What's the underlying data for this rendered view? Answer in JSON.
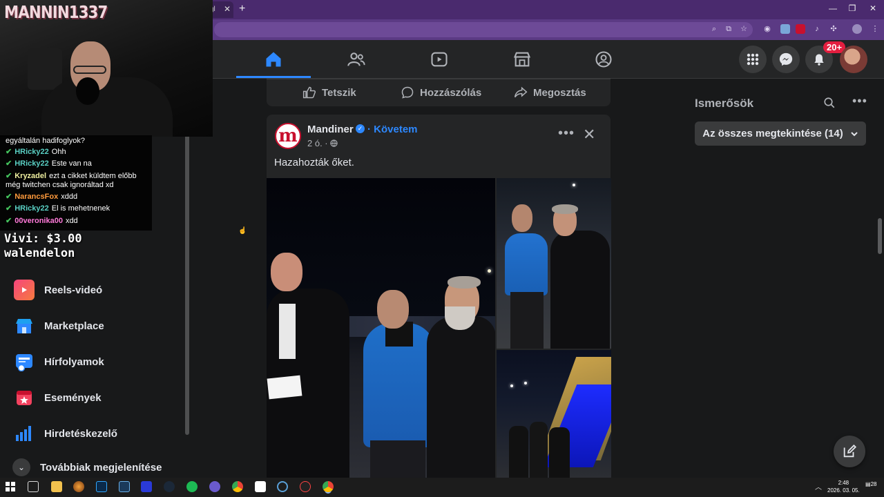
{
  "browser": {
    "tab_title": "gl",
    "tab_close": "✕",
    "new_tab": "+",
    "window_buttons": [
      "—",
      "❐",
      "✕"
    ]
  },
  "overlay": {
    "streamer_name": "MANNIN1337",
    "chat": [
      {
        "user": "",
        "user_color": "#ffffff",
        "badge": "",
        "message": "egyáltalán hadifoglyok?"
      },
      {
        "user": "HRicky22",
        "user_color": "#5ad0c4",
        "badge": "✔",
        "message": "Ohh"
      },
      {
        "user": "HRicky22",
        "user_color": "#5ad0c4",
        "badge": "✔",
        "message": "Este van na"
      },
      {
        "user": "Kryzadel",
        "user_color": "#f0f0a0",
        "badge": "✔",
        "message": "ezt a cikket küldtem előbb"
      },
      {
        "user": "",
        "user_color": "#ffffff",
        "badge": "",
        "message": "még twitchen csak ignoráltad xd"
      },
      {
        "user": "NarancsFox",
        "user_color": "#ff9a3c",
        "badge": "✔",
        "message": "xddd"
      },
      {
        "user": "HRicky22",
        "user_color": "#5ad0c4",
        "badge": "✔",
        "message": "El is mehetnenek"
      },
      {
        "user": "00veronika00",
        "user_color": "#ff7ad9",
        "badge": "✔",
        "message": "xdd"
      }
    ],
    "donation_line1": "Vivi: $3.00",
    "donation_line2": "walendelon"
  },
  "sidebar": {
    "items": [
      {
        "label": "Reels-videó",
        "icon": "reels-icon"
      },
      {
        "label": "Marketplace",
        "icon": "marketplace-icon"
      },
      {
        "label": "Hírfolyamok",
        "icon": "feeds-icon"
      },
      {
        "label": "Események",
        "icon": "events-icon"
      },
      {
        "label": "Hirdetéskezelő",
        "icon": "ads-manager-icon"
      }
    ],
    "more_label": "Továbbiak megjelenítése"
  },
  "feed": {
    "actions": {
      "like": "Tetszik",
      "comment": "Hozzászólás",
      "share": "Megosztás"
    },
    "post": {
      "page_logo_letter": "m",
      "page_name": "Mandiner",
      "follow_label": "· Követem",
      "time": "2 ó. ·",
      "text": "Hazahozták őket."
    }
  },
  "right": {
    "friends_title": "Ismerősök",
    "see_all": "Az összes megtekintése (14)"
  },
  "notifications": {
    "badge": "20+"
  },
  "taskbar": {
    "time": "2:48",
    "date": "2026. 03. 05.",
    "notif_count": "28"
  },
  "colors": {
    "accent": "#2d88ff",
    "surface": "#242526",
    "background": "#18191a",
    "browser_frame": "#4a2a6e"
  }
}
